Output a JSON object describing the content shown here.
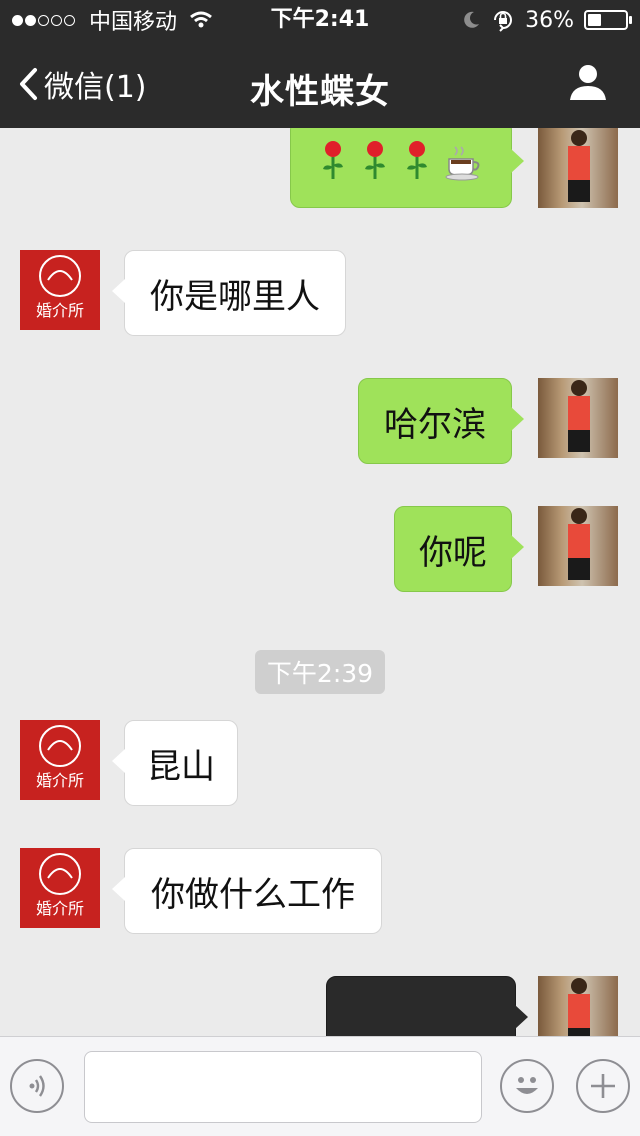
{
  "status_bar": {
    "signal_filled": 2,
    "signal_total": 5,
    "carrier": "中国移动",
    "time": "下午2:41",
    "battery": "36%",
    "battery_level": 0.36
  },
  "nav": {
    "back_label": "微信(1)",
    "title": "水性蝶女"
  },
  "messages": [
    {
      "side": "right",
      "content": "emoji"
    },
    {
      "side": "left",
      "text": "你是哪里人"
    },
    {
      "side": "right",
      "text": "哈尔滨"
    },
    {
      "side": "right",
      "text": "你呢"
    },
    {
      "timestamp": "下午2:39"
    },
    {
      "side": "left",
      "text": "昆山"
    },
    {
      "side": "left",
      "text": "你做什么工作"
    },
    {
      "side": "right",
      "content": "redacted"
    }
  ],
  "avatar_left_text": "婚介所",
  "colors": {
    "nav_bg": "#2b2b2b",
    "chat_bg": "#ebebeb",
    "bubble_sent": "#9fe25a",
    "bubble_received": "#ffffff"
  }
}
